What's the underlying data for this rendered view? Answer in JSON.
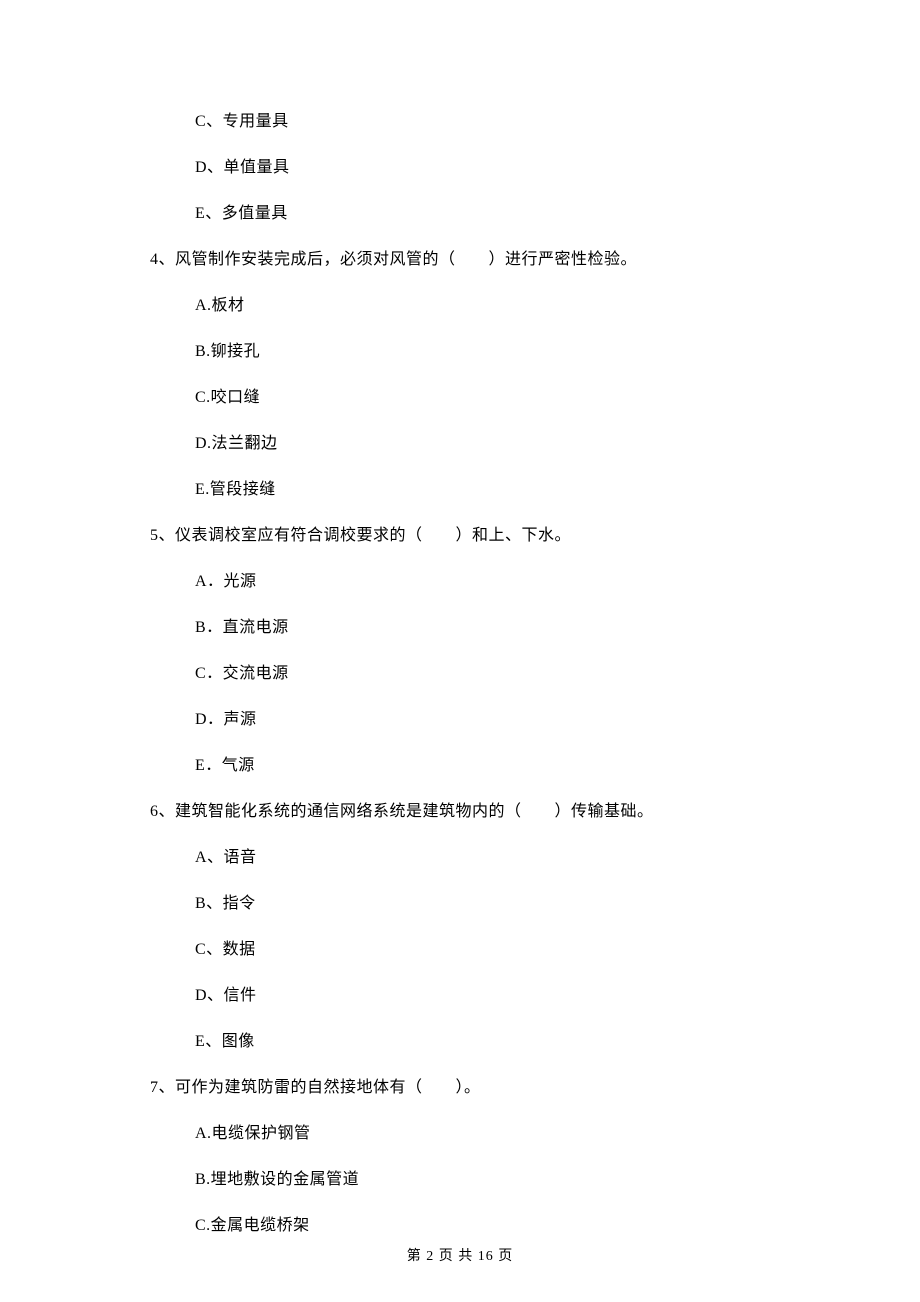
{
  "q3_options": {
    "c": "C、专用量具",
    "d": "D、单值量具",
    "e": "E、多值量具"
  },
  "q4": {
    "stem": "4、风管制作安装完成后，必须对风管的（　　）进行严密性检验。",
    "a": "A.板材",
    "b": "B.铆接孔",
    "c": "C.咬口缝",
    "d": "D.法兰翻边",
    "e": "E.管段接缝"
  },
  "q5": {
    "stem": "5、仪表调校室应有符合调校要求的（　　）和上、下水。",
    "a": "A．光源",
    "b": "B．直流电源",
    "c": "C．交流电源",
    "d": "D．声源",
    "e": "E．气源"
  },
  "q6": {
    "stem": "6、建筑智能化系统的通信网络系统是建筑物内的（　　）传输基础。",
    "a": "A、语音",
    "b": "B、指令",
    "c": "C、数据",
    "d": "D、信件",
    "e": "E、图像"
  },
  "q7": {
    "stem": "7、可作为建筑防雷的自然接地体有（　　）。",
    "a": "A.电缆保护钢管",
    "b": "B.埋地敷设的金属管道",
    "c": "C.金属电缆桥架"
  },
  "footer": "第 2 页 共 16 页"
}
